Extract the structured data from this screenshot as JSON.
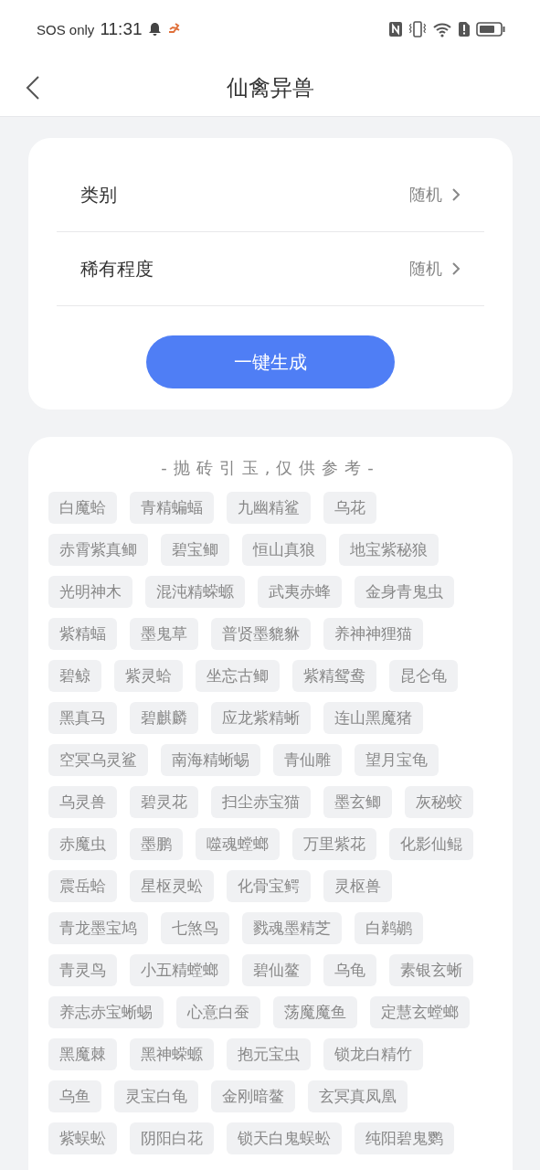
{
  "status_bar": {
    "network_text": "SOS only",
    "time": "11:31"
  },
  "header": {
    "title": "仙禽异兽"
  },
  "filters": [
    {
      "label": "类别",
      "value": "随机"
    },
    {
      "label": "稀有程度",
      "value": "随机"
    }
  ],
  "generate_button": {
    "label": "一键生成"
  },
  "suggestions": {
    "heading": "-抛砖引玉,仅供参考-",
    "tag_rows": [
      [
        "白魔蛤",
        "青精蝙蝠",
        "九幽精鲨",
        "乌花"
      ],
      [
        "赤霄紫真鲫",
        "碧宝鲫",
        "恒山真狼",
        "地宝紫秘狼"
      ],
      [
        "光明神木",
        "混沌精蝾螈",
        "武夷赤蜂",
        "金身青鬼虫"
      ],
      [
        "紫精蝠",
        "墨鬼草",
        "普贤墨貔貅",
        "养神神狸猫"
      ],
      [
        "碧鲸",
        "紫灵蛤",
        "坐忘古鲫",
        "紫精鸳鸯",
        "昆仑龟"
      ],
      [
        "黑真马",
        "碧麒麟",
        "应龙紫精蜥",
        "连山黑魔猪"
      ],
      [
        "空冥乌灵鲨",
        "南海精蜥蜴",
        "青仙雕",
        "望月宝龟"
      ],
      [
        "乌灵兽",
        "碧灵花",
        "扫尘赤宝猫",
        "墨玄鲫",
        "灰秘蛟"
      ],
      [
        "赤魔虫",
        "墨鹏",
        "噬魂螳螂",
        "万里紫花",
        "化影仙鲲"
      ],
      [
        "震岳蛤",
        "星枢灵蚣",
        "化骨宝鳄",
        "灵枢兽"
      ],
      [
        "青龙墨宝鸠",
        "七煞鸟",
        "戮魂墨精芝",
        "白鹈鹕"
      ],
      [
        "青灵鸟",
        "小五精螳螂",
        "碧仙鳌",
        "乌龟",
        "素银玄蜥"
      ],
      [
        "养志赤宝蜥蜴",
        "心意白蚕",
        "荡魔魔鱼",
        "定慧玄螳螂"
      ],
      [
        "黑魔棘",
        "黑神蝾螈",
        "抱元宝虫",
        "锁龙白精竹"
      ],
      [
        "乌鱼",
        "灵宝白龟",
        "金刚暗鳌",
        "玄冥真凤凰"
      ],
      [
        "紫蜈蚣",
        "阴阳白花",
        "锁天白鬼蜈蚣",
        "纯阳碧鬼鹦"
      ]
    ]
  }
}
